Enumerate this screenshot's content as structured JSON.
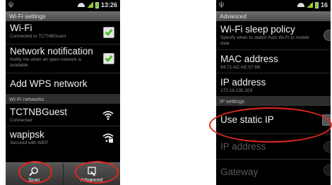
{
  "left": {
    "status_time": "13:26",
    "title": "Wi-Fi settings",
    "wifi": {
      "label": "Wi-Fi",
      "summary": "Connected to TCTNBGuest"
    },
    "network_notification": {
      "label": "Network notification",
      "summary": "Notify me when an open network is available"
    },
    "add_wps": {
      "label": "Add WPS network"
    },
    "networks_header": "Wi-Fi networks",
    "networks": [
      {
        "name": "TCTNBGuest",
        "status": "Connected",
        "icon": "wifi-signal-icon"
      },
      {
        "name": "wapipsk",
        "status": "Secured with WEP",
        "icon": "wifi-secured-icon"
      }
    ],
    "menu": {
      "scan_label": "Scan",
      "advanced_label": "Advanced"
    }
  },
  "right": {
    "status_time": "16",
    "title": "Advanced",
    "sleep_policy": {
      "label": "Wi-Fi sleep policy",
      "summary": "Specify when to switch from Wi-Fi to mobile data"
    },
    "mac": {
      "label": "MAC address",
      "value": "94:71:AC:AE:57:6B"
    },
    "ip": {
      "label": "IP address",
      "value": "172.16.135.203"
    },
    "ip_settings_header": "IP settings",
    "use_static_ip": {
      "label": "Use static IP"
    },
    "static_ip_address": {
      "label": "IP address"
    },
    "gateway": {
      "label": "Gateway"
    }
  },
  "colors": {
    "check_green": "#4cbf28",
    "highlight_red": "#e1271f",
    "title_bar": "#5a5a5a"
  }
}
